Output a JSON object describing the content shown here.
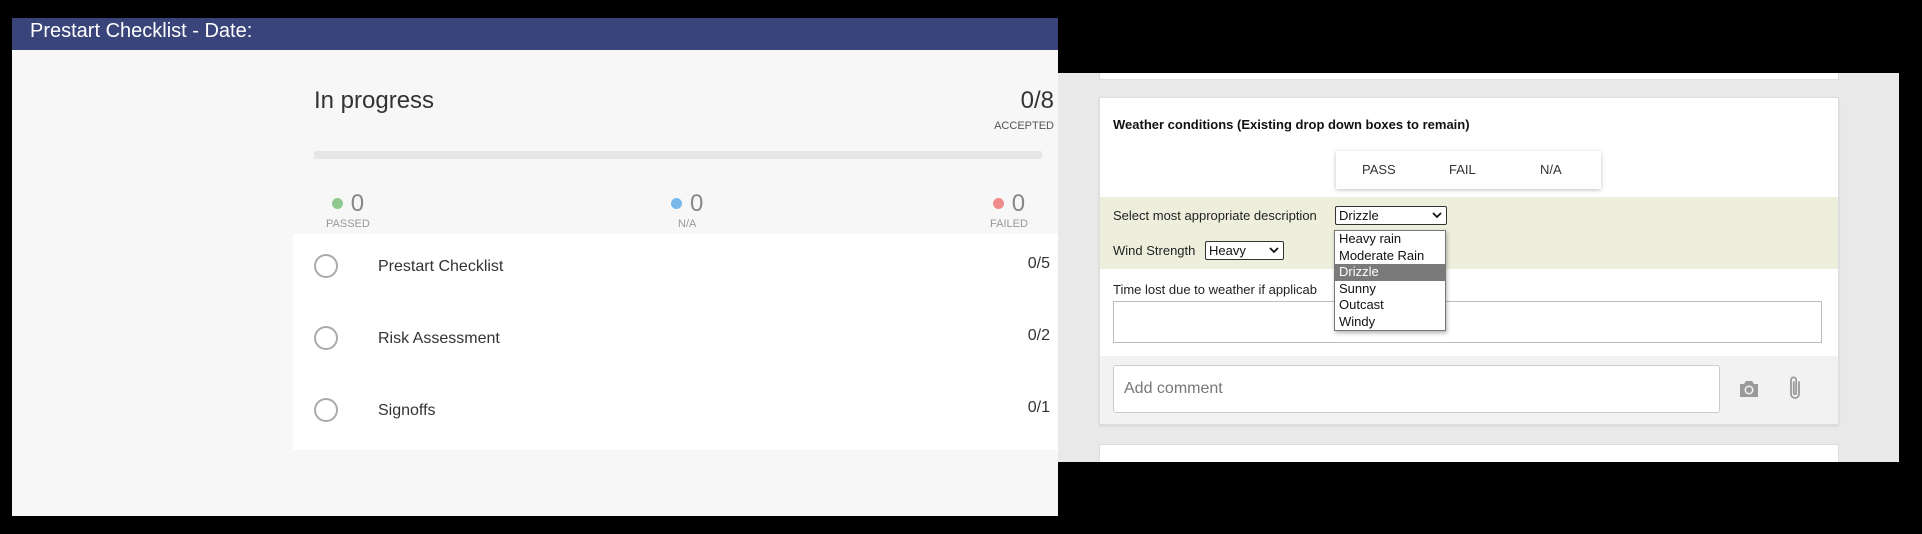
{
  "checklist": {
    "header_title": "Prestart Checklist - Date:",
    "status_label": "In progress",
    "accepted_count": "0/8",
    "accepted_label": "ACCEPTED",
    "progress_fraction": 0,
    "stats": {
      "passed": {
        "value": "0",
        "label": "PASSED",
        "color": "#8fc98f"
      },
      "na": {
        "value": "0",
        "label": "N/A",
        "color": "#79b8ea"
      },
      "failed": {
        "value": "0",
        "label": "FAILED",
        "color": "#ef8b8b"
      }
    },
    "sections": [
      {
        "name": "Prestart Checklist",
        "score": "0/5"
      },
      {
        "name": "Risk Assessment",
        "score": "0/2"
      },
      {
        "name": "Signoffs",
        "score": "0/1"
      }
    ]
  },
  "weather_card": {
    "title": "Weather conditions (Existing drop down boxes to remain)",
    "result_buttons": {
      "pass": "PASS",
      "fail": "FAIL",
      "na": "N/A"
    },
    "description_label": "Select most appropriate description",
    "description_value": "Drizzle",
    "description_options": [
      "Heavy rain",
      "Moderate Rain",
      "Drizzle",
      "Sunny",
      "Outcast",
      "Windy"
    ],
    "description_selected_index": 2,
    "wind_label": "Wind Strength",
    "wind_value": "Heavy",
    "time_lost_label": "Time lost due to weather if applicab",
    "time_lost_value": "",
    "comment_placeholder": "Add comment",
    "icons": {
      "camera": "camera-icon",
      "attach": "paperclip-icon",
      "dropdown": "chevron-down-icon"
    }
  }
}
